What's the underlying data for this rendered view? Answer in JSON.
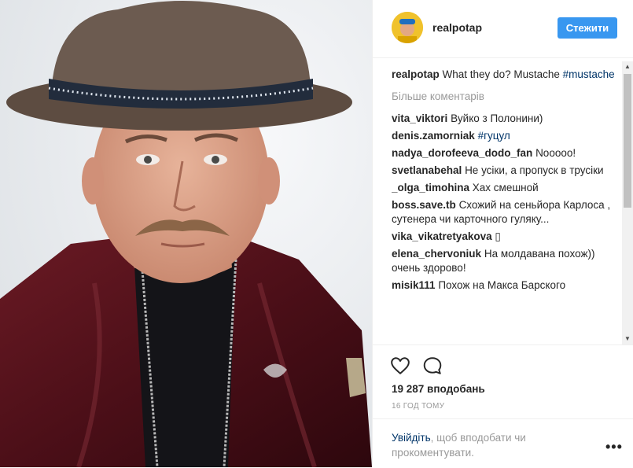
{
  "post": {
    "author": "realpotap",
    "follow_label": "Стежити",
    "caption_text": "What they do? Mustache",
    "caption_tag": "#mustache",
    "more_comments": "Більше коментарів",
    "likes": "19 287 вподобань",
    "time": "16 ГОД ТОМУ"
  },
  "comments": [
    {
      "user": "vita_viktori",
      "text": "Вуйко з Полонини)",
      "tag": ""
    },
    {
      "user": "denis.zamorniak",
      "text": "",
      "tag": "#гуцул"
    },
    {
      "user": "nadya_dorofeeva_dodo_fan",
      "text": "Nooooo!",
      "tag": ""
    },
    {
      "user": "svetlanabehal",
      "text": "Не усіки, а пропуск в трусіки",
      "tag": ""
    },
    {
      "user": "_olga_timohina",
      "text": "Хах смешной",
      "tag": ""
    },
    {
      "user": "boss.save.tb",
      "text": "Схожий на сеньйора Карлоса , сутенера чи карточного гуляку...",
      "tag": ""
    },
    {
      "user": "vika_vikatretyakova",
      "text": "▯",
      "tag": ""
    },
    {
      "user": "elena_chervoniuk",
      "text": "На молдавана похож)) очень здорово!",
      "tag": ""
    },
    {
      "user": "misik111",
      "text": "Похож на Макса Барского",
      "tag": ""
    }
  ],
  "login": {
    "link": "Увійдіть",
    "rest": ", щоб вподобати чи прокоментувати."
  },
  "icons": {
    "like": "heart-icon",
    "comment": "speech-bubble-icon",
    "more": "more-dots-icon"
  },
  "colors": {
    "follow_button": "#3897f0",
    "link": "#003569",
    "muted": "#999999"
  }
}
